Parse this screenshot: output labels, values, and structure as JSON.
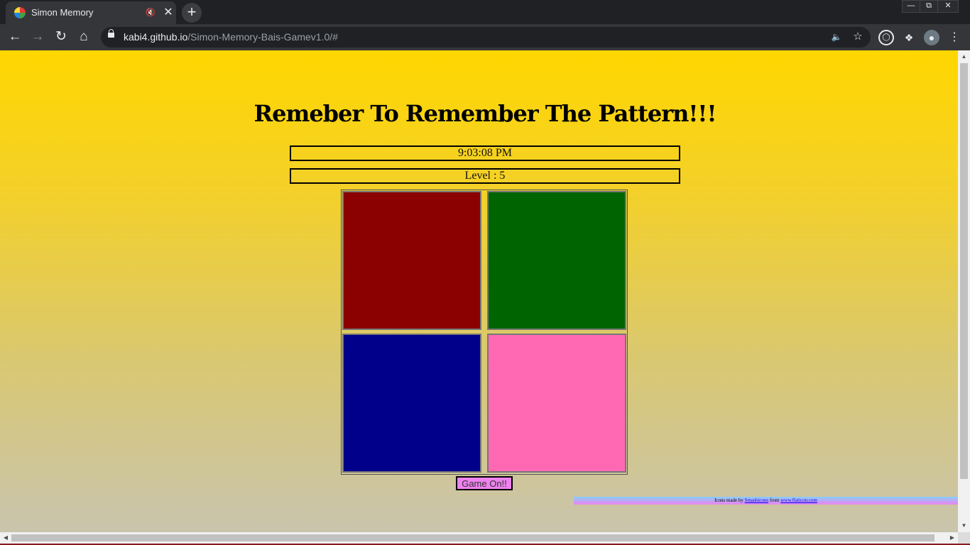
{
  "browser": {
    "tab_title": "Simon Memory",
    "new_tab_symbol": "+",
    "url_host": "kabi4.github.io",
    "url_path": "/Simon-Memory-Bais-Gamev1.0/#",
    "icons": [
      "back-arrow-icon",
      "forward-arrow-icon",
      "reload-icon",
      "home-icon",
      "lock-icon",
      "mute-icon",
      "star-icon",
      "extension-icon",
      "puzzle-icon",
      "profile-avatar-icon",
      "menu-dots-icon"
    ]
  },
  "page": {
    "heading": "Remeber To Remember The Pattern!!!",
    "clock": "9:03:08 PM",
    "level_text": "Level : 5",
    "pads": [
      {
        "name": "red",
        "color": "#8b0000"
      },
      {
        "name": "green",
        "color": "#006400"
      },
      {
        "name": "blue",
        "color": "#00008b"
      },
      {
        "name": "pink",
        "color": "#ff69b4"
      }
    ],
    "start_button": "Game On!!",
    "credits": {
      "prefix": "Icons made by ",
      "author": "Smashicons",
      "middle": " from ",
      "site": "www.flaticon.com"
    }
  }
}
